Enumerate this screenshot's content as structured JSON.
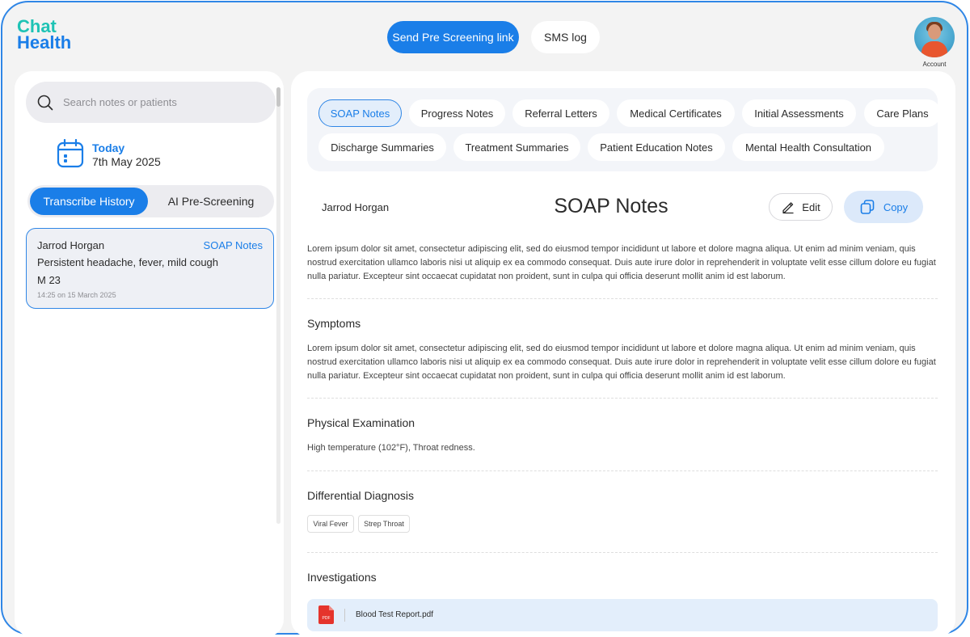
{
  "app": {
    "logo_line1": "Chat",
    "logo_line2": "Health",
    "send_button": "Send Pre Screening link",
    "sms_button": "SMS log",
    "account_label": "Account"
  },
  "sidebar": {
    "search_placeholder": "Search notes or patients",
    "date_label": "Today",
    "date_value": "7th May 2025",
    "toggle": [
      "Transcribe History",
      "AI Pre-Screening"
    ],
    "active_toggle": "Transcribe History",
    "records": [
      {
        "name": "Jarrod Horgan",
        "note_type": "SOAP Notes",
        "symptoms": "Persistent headache, fever, mild cough",
        "demographics": "M 23",
        "timestamp": "14:25 on 15 March 2025"
      }
    ]
  },
  "main": {
    "tabs": [
      "SOAP Notes",
      "Progress Notes",
      "Referral Letters",
      "Medical Certificates",
      "Initial Assessments",
      "Care Plans",
      "Discharge Summaries",
      "Treatment Summaries",
      "Patient Education Notes",
      "Mental Health Consultation"
    ],
    "active_tab": "SOAP Notes",
    "patient_name": "Jarrod Horgan",
    "title": "SOAP Notes",
    "edit_label": "Edit",
    "copy_label": "Copy",
    "intro": "Lorem ipsum dolor sit amet, consectetur adipiscing elit, sed do eiusmod tempor incididunt ut labore et dolore magna aliqua. Ut enim ad minim veniam, quis nostrud exercitation ullamco laboris nisi ut aliquip ex ea commodo consequat. Duis aute irure dolor in reprehenderit in voluptate velit esse cillum dolore eu fugiat nulla pariatur. Excepteur sint occaecat cupidatat non proident, sunt in culpa qui officia deserunt mollit anim id est laborum.",
    "sections": {
      "symptoms": {
        "title": "Symptoms",
        "text": "Lorem ipsum dolor sit amet, consectetur adipiscing elit, sed do eiusmod tempor incididunt ut labore et dolore magna aliqua. Ut enim ad minim veniam, quis nostrud exercitation ullamco laboris nisi ut aliquip ex ea commodo consequat. Duis aute irure dolor in reprehenderit in voluptate velit esse cillum dolore eu fugiat nulla pariatur. Excepteur sint occaecat cupidatat non proident, sunt in culpa qui officia deserunt mollit anim id est laborum."
      },
      "physical_exam": {
        "title": "Physical Examination",
        "text": "High temperature (102°F), Throat redness."
      },
      "differential": {
        "title": "Differential Diagnosis",
        "tags": [
          "Viral Fever",
          "Strep Throat"
        ]
      },
      "investigations": {
        "title": "Investigations",
        "file_name": "Blood Test Report.pdf",
        "file_badge": "PDF"
      }
    }
  },
  "colors": {
    "brand_blue": "#1a7ee8",
    "brand_teal": "#1fc3b5",
    "pdf_red": "#e5342c"
  }
}
